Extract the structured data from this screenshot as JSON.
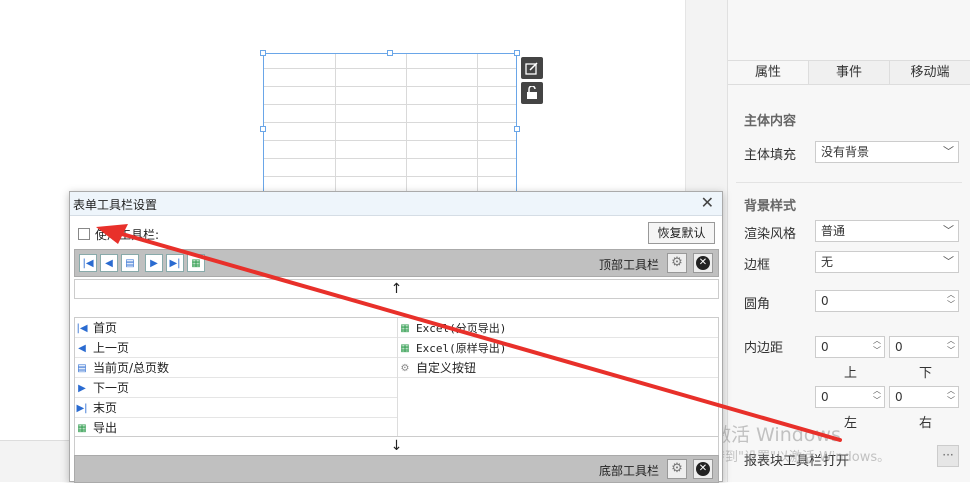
{
  "canvas": {
    "edit_icon": "pencil-square-icon",
    "lock_icon": "unlock-icon"
  },
  "right_panel": {
    "tabs": [
      {
        "label": "属性",
        "active": true
      },
      {
        "label": "事件",
        "active": false
      },
      {
        "label": "移动端",
        "active": false
      }
    ],
    "main_content_title": "主体内容",
    "fill_label": "主体填充",
    "fill_value": "没有背景",
    "bg_style_title": "背景样式",
    "render_label": "渲染风格",
    "render_value": "普通",
    "border_label": "边框",
    "border_value": "无",
    "radius_label": "圆角",
    "radius_value": "0",
    "padding_label": "内边距",
    "padding_top": "0",
    "padding_bottom": "0",
    "padding_left": "0",
    "padding_right": "0",
    "top_label": "上",
    "bottom_label": "下",
    "left_label": "左",
    "right_label": "右",
    "toolbar_label": "报表块工具栏",
    "toolbar_value": "打开",
    "dots_label": "···"
  },
  "watermark": {
    "line1": "激活 Windows",
    "line2": "转到\"设置\"以激活 Windows。"
  },
  "dialog": {
    "title": "表单工具栏设置",
    "use_toolbar_label": "使用工具栏:",
    "restore_label": "恢复默认",
    "top_toolbar_label": "顶部工具栏",
    "bottom_toolbar_label": "底部工具栏",
    "up_arrow": "↑",
    "down_arrow": "↓",
    "left_items": [
      {
        "label": "首页",
        "icon": "first-page-icon"
      },
      {
        "label": "上一页",
        "icon": "prev-page-icon"
      },
      {
        "label": "当前页/总页数",
        "icon": "page-count-icon"
      },
      {
        "label": "下一页",
        "icon": "next-page-icon"
      },
      {
        "label": "末页",
        "icon": "last-page-icon"
      },
      {
        "label": "导出",
        "icon": "export-icon"
      }
    ],
    "right_items": [
      {
        "label": "Excel(分页导出)",
        "icon": "excel-icon"
      },
      {
        "label": "Excel(原样导出)",
        "icon": "excel-icon"
      },
      {
        "label": "自定义按钮",
        "icon": "gear-icon"
      }
    ]
  },
  "colors": {
    "annotation_arrow": "#e8302a",
    "selection_blue": "#6aa6e8"
  }
}
